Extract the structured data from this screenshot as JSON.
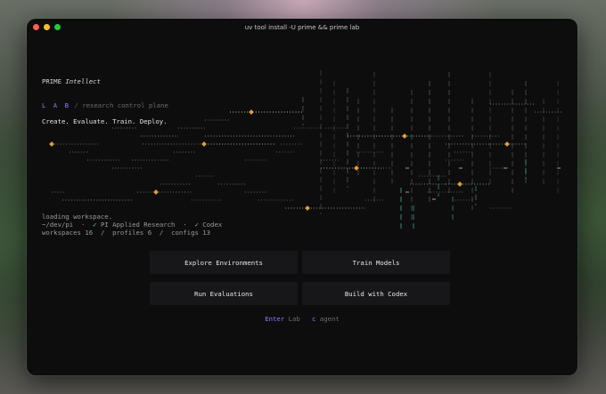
{
  "window": {
    "title": "uv tool install -U prime && prime lab"
  },
  "brand": {
    "name": "PRIME",
    "suffix": "Intellect"
  },
  "lab": {
    "letters": "L A B",
    "separator": "/",
    "subtitle": "research control plane"
  },
  "tagline": "Create. Evaluate. Train. Deploy.",
  "status": {
    "loading": "loading workspace.",
    "path": "~/dev/pi",
    "bullet": "·",
    "check": "✓",
    "org": "PI Applied Research",
    "agent": "Codex",
    "workspaces_label": "workspaces",
    "workspaces": "16",
    "profiles_label": "profiles",
    "profiles": "6",
    "configs_label": "configs",
    "configs": "13",
    "slash": "/"
  },
  "actions": {
    "explore": "Explore Environments",
    "train": "Train Models",
    "evaluate": "Run Evaluations",
    "build": "Build with Codex"
  },
  "hints": {
    "enter_key": "Enter",
    "enter_label": "Lab",
    "c_key": "c",
    "c_label": "agent"
  },
  "colors": {
    "accent": "#8f7bff",
    "node": "#e0a23c",
    "teal": "#3fae9c"
  }
}
